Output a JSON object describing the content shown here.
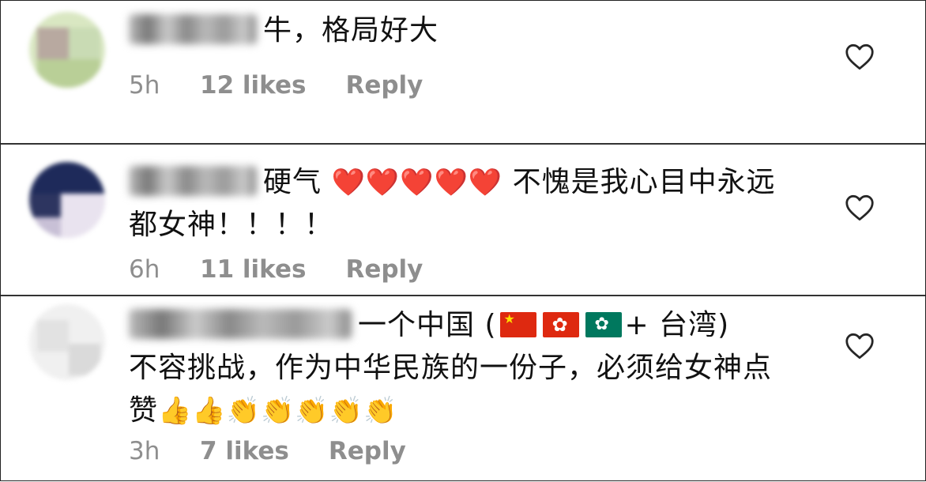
{
  "comments": [
    {
      "text": "牛，格局好大",
      "time": "5h",
      "likes": "12 likes",
      "reply": "Reply"
    },
    {
      "text_before": "硬气",
      "emoji_hearts": "❤️❤️❤️❤️❤️",
      "text_after": "不愧是我心目中永远都女神！！！！",
      "time": "6h",
      "likes": "11 likes",
      "reply": "Reply"
    },
    {
      "text_part1": "一个中国 (",
      "text_part2": "+ 台湾)",
      "text_part3": "不容挑战，作为中华民族的一份子，必须给女神点赞",
      "emoji_thumbs": "👍👍",
      "emoji_claps": "👏👏👏👏👏",
      "time": "3h",
      "likes": "7 likes",
      "reply": "Reply"
    }
  ],
  "icons": {
    "like": "heart-outline-icon"
  },
  "colors": {
    "text": "#111111",
    "meta": "#8e8e8e",
    "border": "#333333"
  }
}
